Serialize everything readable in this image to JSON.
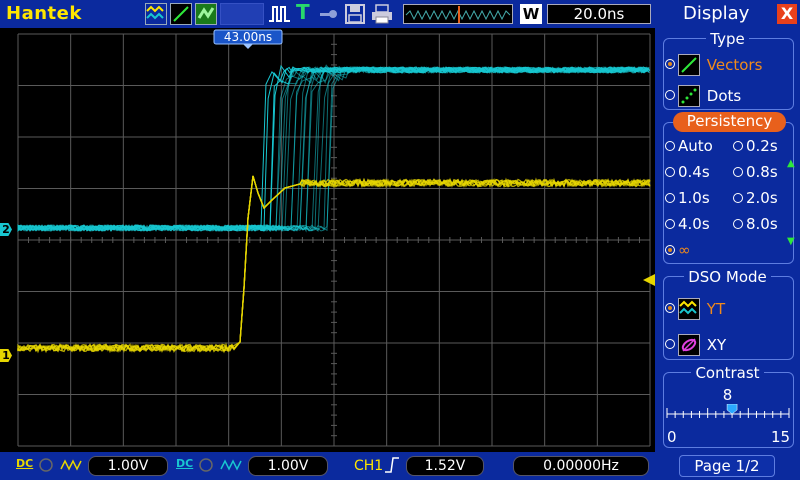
{
  "topbar": {
    "brand": "Hantek",
    "w_label": "W",
    "timebase": "20.0ns"
  },
  "plot": {
    "trigger_time_label": "43.00ns",
    "ch2_marker": "2",
    "ch1_marker": "1",
    "colors": {
      "ch1": "#e6d600",
      "ch2": "#18c6d0",
      "grid": "#5a5a5a"
    }
  },
  "bottombar": {
    "ch1_coupling": "DC",
    "ch1_volts": "1.00V",
    "ch2_coupling": "DC",
    "ch2_volts": "1.00V",
    "trigger_source": "CH1",
    "trigger_level": "1.52V",
    "frequency": "0.00000Hz"
  },
  "panel": {
    "title": "Display",
    "close_glyph": "X",
    "type": {
      "title": "Type",
      "options": [
        {
          "label": "Vectors",
          "selected": true,
          "icon": "vectors-icon"
        },
        {
          "label": "Dots",
          "selected": false,
          "icon": "dots-icon"
        }
      ]
    },
    "persistency": {
      "title": "Persistency",
      "options": [
        {
          "label": "Auto"
        },
        {
          "label": "0.2s"
        },
        {
          "label": "0.4s"
        },
        {
          "label": "0.8s"
        },
        {
          "label": "1.0s"
        },
        {
          "label": "2.0s"
        },
        {
          "label": "4.0s"
        },
        {
          "label": "8.0s"
        },
        {
          "label": "∞",
          "selected": true
        }
      ]
    },
    "dso_mode": {
      "title": "DSO Mode",
      "options": [
        {
          "label": "YT",
          "selected": true,
          "icon": "yt-wave-icon"
        },
        {
          "label": "XY",
          "selected": false,
          "icon": "xy-lissajous-icon"
        }
      ]
    },
    "contrast": {
      "title": "Contrast",
      "value": "8",
      "min": "0",
      "max": "15",
      "level": 8
    },
    "page": "Page 1/2"
  }
}
